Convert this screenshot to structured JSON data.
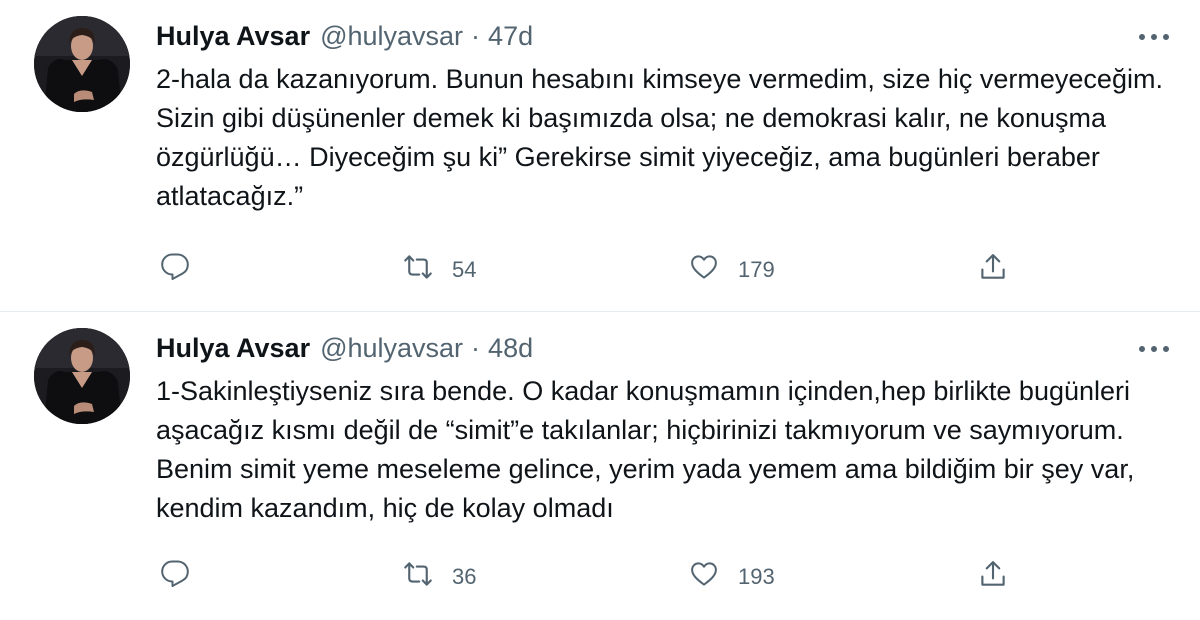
{
  "tweets": [
    {
      "author": {
        "name": "Hulya Avsar",
        "handle": "@hulyavsar"
      },
      "separator": "·",
      "time": "47d",
      "text": "2-hala da kazanıyorum. Bunun hesabını kimseye vermedim, size hiç vermeyeceğim. Sizin gibi düşünenler demek ki başımızda olsa; ne demokrasi kalır, ne konuşma özgürlüğü… Diyeceğim şu ki” Gerekirse simit yiyeceğiz, ama bugünleri beraber atlatacağız.”",
      "retweets": "54",
      "likes": "179"
    },
    {
      "author": {
        "name": "Hulya Avsar",
        "handle": "@hulyavsar"
      },
      "separator": "·",
      "time": "48d",
      "text": "1-Sakinleştiyseniz sıra bende. O kadar konuşmamın içinden,hep birlikte bugünleri aşacağız kısmı değil de “simit”e takılanlar; hiçbirinizi takmıyorum ve saymıyorum. Benim simit yeme meseleme gelince, yerim yada yemem ama bildiğim bir şey var, kendim kazandım, hiç de kolay olmadı",
      "retweets": "36",
      "likes": "193"
    }
  ],
  "icons": {
    "reply": "reply-icon",
    "retweet": "retweet-icon",
    "like": "heart-icon",
    "share": "share-icon",
    "more": "more-icon"
  },
  "colors": {
    "text": "#0f1419",
    "secondary": "#536471",
    "divider": "#e6ecf0"
  }
}
